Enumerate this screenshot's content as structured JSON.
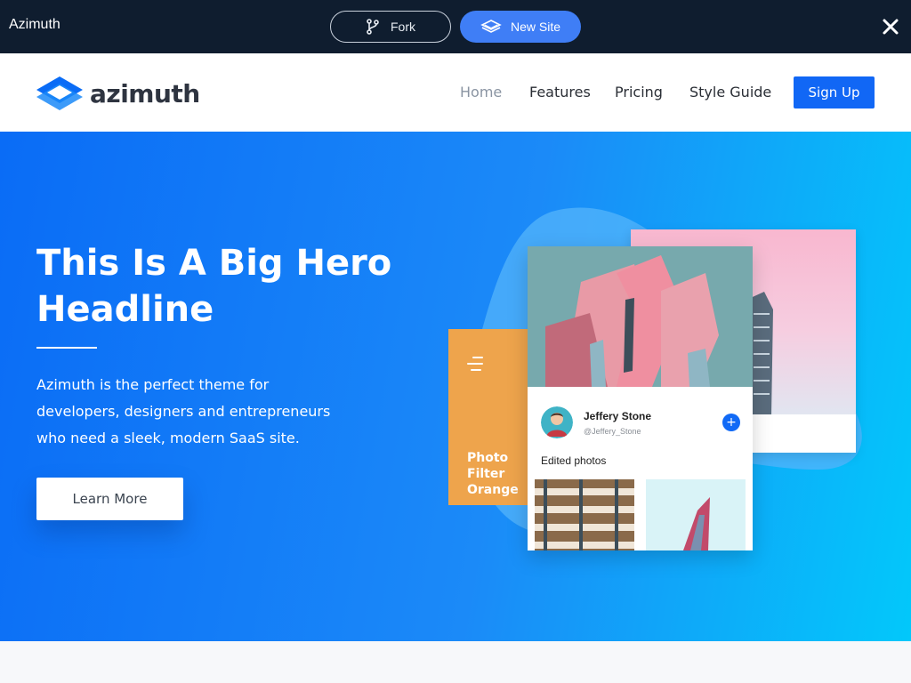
{
  "topbar": {
    "app_title": "Azimuth",
    "fork_label": "Fork",
    "new_site_label": "New Site"
  },
  "navbar": {
    "logo_text": "azimuth",
    "links": [
      "Home",
      "Features",
      "Pricing",
      "Style Guide"
    ],
    "active_link": "Home",
    "signup_label": "Sign Up"
  },
  "hero": {
    "title": "This Is A Big Hero Headline",
    "body": "Azimuth is the perfect theme for developers, designers and entrepreneurs who need a sleek, modern SaaS site.",
    "cta_label": "Learn More"
  },
  "illustration": {
    "orange_card_caption": "Photo Filter Orange",
    "profile_name": "Jeffery Stone",
    "profile_handle": "@Jeffery_Stone",
    "plus_symbol": "+",
    "edited_label": "Edited photos"
  },
  "colors": {
    "topbar_bg": "#0f1d2f",
    "accent": "#1167f5",
    "hero_start": "#0a6cf6",
    "hero_end": "#02c8fa",
    "orange": "#eea44c"
  },
  "icons": [
    "fork-icon",
    "layers-icon",
    "close-icon",
    "azimuth-logo-icon",
    "menu-lines-icon"
  ]
}
